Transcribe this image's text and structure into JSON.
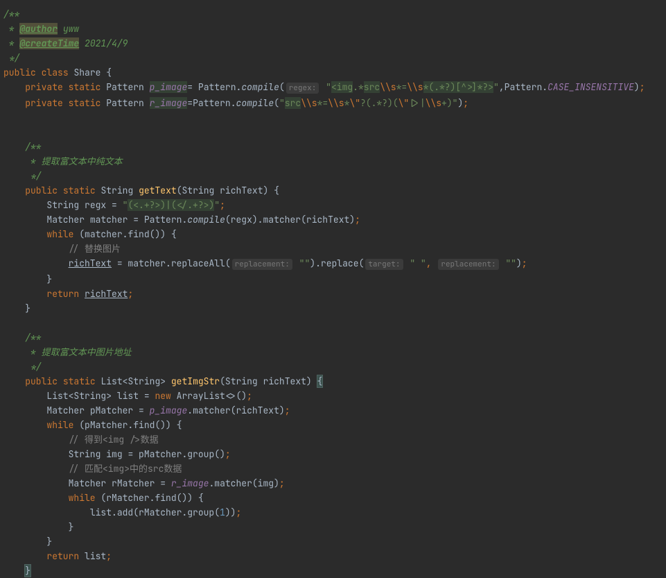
{
  "doc1": {
    "open": "/**",
    "authorTag": "@author",
    "authorName": "yww",
    "createTag": "@createTime",
    "createDate": "2021/4/9",
    "close": "*/",
    "star": " * "
  },
  "class": {
    "kw_public": "public",
    "kw_class": "class",
    "name": "Share",
    "brace": "{",
    "kw_private": "private",
    "kw_static": "static",
    "type_pattern": "Pattern",
    "field1": "p_image",
    "field2": "r_image",
    "eq": "=",
    "dot": ".",
    "compile": "compile",
    "lparen": "(",
    "rparen": ")",
    "semi": ";",
    "pattern_const": "Pattern",
    "case_ins": "CASE_INSENSITIVE",
    "comma": ",",
    "hint_regex": "regex:",
    "s1_p1": "\"",
    "s1_p2": "<img",
    "s1_p3": ".*",
    "s1_p4": "src",
    "s1_e1": "\\\\s",
    "s1_p5": "*=",
    "s1_e2": "\\\\s",
    "s1_p6": "*(.*?)[^>]*?>",
    "s1_p7": "\"",
    "s2_p1": "\"",
    "s2_p2": "src",
    "s2_e1": "\\\\s",
    "s2_p3": "*=",
    "s2_e2": "\\\\s",
    "s2_p4": "*",
    "s2_e3": "\\\"",
    "s2_p5": "?(.*?)(",
    "s2_e4": "\\\"",
    "s2_p6": "|>|",
    "s2_e5": "\\\\s",
    "s2_p7": "+)",
    "s2_p8": "\""
  },
  "m1": {
    "doc_open": "/**",
    "doc_star": " * ",
    "doc_text": "提取富文本中纯文本",
    "doc_close": " */",
    "kw_public": "public",
    "kw_static": "static",
    "ret": "String",
    "name": "getText",
    "param_t": "String",
    "param_n": "richText",
    "var_string": "String",
    "var_regx": "regx",
    "eq": " = ",
    "regx_p1": "\"",
    "regx_p2": "(<.+?>)|(</.+?>)",
    "regx_p3": "\"",
    "semi": ";",
    "var_matcher_t": "Matcher",
    "var_matcher_n": "matcher",
    "pattern": "Pattern",
    "compile": "compile",
    "matcher_call": "matcher",
    "kw_while": "while",
    "find": "find",
    "comment1": "// 替换图片",
    "richText_u": "richText",
    "replaceAll": "replaceAll",
    "hint_repl": "replacement:",
    "empty": "\"\"",
    "replace": "replace",
    "hint_target": "target:",
    "space_str": "\" \"",
    "kw_return": "return"
  },
  "m2": {
    "doc_open": "/**",
    "doc_star": " * ",
    "doc_text": "提取富文本中图片地址",
    "doc_close": " */",
    "kw_public": "public",
    "kw_static": "static",
    "ret": "List<String>",
    "name": "getImgStr",
    "param_t": "String",
    "param_n": "richText",
    "list_t": "List<String>",
    "list_n": "list",
    "kw_new": "new",
    "arraylist": "ArrayList<>()",
    "matcher_t": "Matcher",
    "pMatcher": "pMatcher",
    "p_image": "p_image",
    "matcher_call": "matcher",
    "kw_while": "while",
    "find": "find",
    "comment2": "// 得到<img />数据",
    "string_t": "String",
    "img_n": "img",
    "group": "group",
    "comment3": "// 匹配<img>中的src数据",
    "rMatcher": "rMatcher",
    "r_image": "r_image",
    "list_add": "list.add",
    "one": "1",
    "kw_return": "return"
  }
}
